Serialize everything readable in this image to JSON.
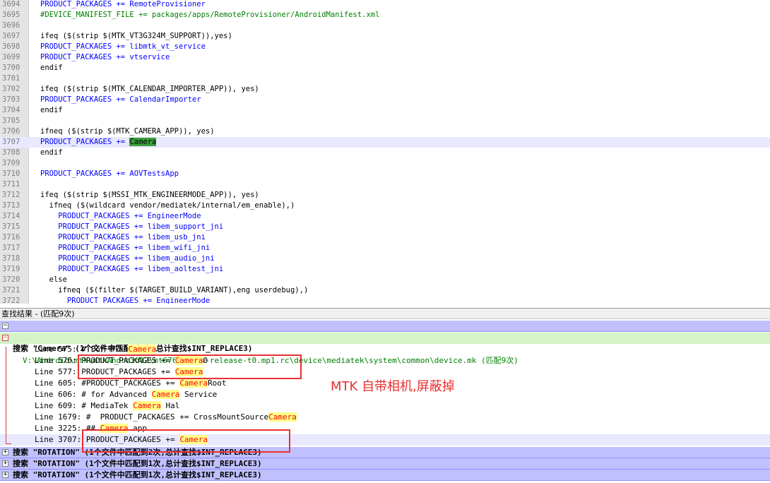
{
  "editor": {
    "lines": [
      {
        "n": "3694",
        "t": "PRODUCT_PACKAGES += RemoteProvisioner",
        "k": "var"
      },
      {
        "n": "3695",
        "t": "#DEVICE_MANIFEST_FILE += packages/apps/RemoteProvisioner/AndroidManifest.xml",
        "k": "comment"
      },
      {
        "n": "3696",
        "t": "",
        "k": "plain"
      },
      {
        "n": "3697",
        "t": "ifeq ($(strip $(MTK_VT3G324M_SUPPORT)),yes)",
        "k": "plain"
      },
      {
        "n": "3698",
        "t": "PRODUCT_PACKAGES += libmtk_vt_service",
        "k": "var"
      },
      {
        "n": "3699",
        "t": "PRODUCT_PACKAGES += vtservice",
        "k": "var"
      },
      {
        "n": "3700",
        "t": "endif",
        "k": "plain"
      },
      {
        "n": "3701",
        "t": "",
        "k": "plain"
      },
      {
        "n": "3702",
        "t": "ifeq ($(strip $(MTK_CALENDAR_IMPORTER_APP)), yes)",
        "k": "plain"
      },
      {
        "n": "3703",
        "t": "PRODUCT_PACKAGES += CalendarImporter",
        "k": "var"
      },
      {
        "n": "3704",
        "t": "endif",
        "k": "plain"
      },
      {
        "n": "3705",
        "t": "",
        "k": "plain"
      },
      {
        "n": "3706",
        "t": "ifneq ($(strip $(MTK_CAMERA_APP)), yes)",
        "k": "plain"
      },
      {
        "n": "3707",
        "t": "PRODUCT_PACKAGES += ",
        "k": "var",
        "hl": "Camera",
        "current": true
      },
      {
        "n": "3708",
        "t": "endif",
        "k": "plain"
      },
      {
        "n": "3709",
        "t": "",
        "k": "plain"
      },
      {
        "n": "3710",
        "t": "PRODUCT_PACKAGES += AOVTestsApp",
        "k": "var"
      },
      {
        "n": "3711",
        "t": "",
        "k": "plain"
      },
      {
        "n": "3712",
        "t": "ifeq ($(strip $(MSSI_MTK_ENGINEERMODE_APP)), yes)",
        "k": "plain"
      },
      {
        "n": "3713",
        "t": "  ifneq ($(wildcard vendor/mediatek/internal/em_enable),)",
        "k": "plain"
      },
      {
        "n": "3714",
        "t": "    PRODUCT_PACKAGES += EngineerMode",
        "k": "var"
      },
      {
        "n": "3715",
        "t": "    PRODUCT_PACKAGES += libem_support_jni",
        "k": "var"
      },
      {
        "n": "3716",
        "t": "    PRODUCT_PACKAGES += libem_usb_jni",
        "k": "var"
      },
      {
        "n": "3717",
        "t": "    PRODUCT_PACKAGES += libem_wifi_jni",
        "k": "var"
      },
      {
        "n": "3718",
        "t": "    PRODUCT_PACKAGES += libem_audio_jni",
        "k": "var"
      },
      {
        "n": "3719",
        "t": "    PRODUCT_PACKAGES += libem_aoltest_jni",
        "k": "var"
      },
      {
        "n": "3720",
        "t": "  else",
        "k": "plain"
      },
      {
        "n": "3721",
        "t": "    ifneq ($(filter $(TARGET_BUILD_VARIANT),eng userdebug),)",
        "k": "plain"
      },
      {
        "n": "3722",
        "t": "      PRODUCT_PACKAGES += EngineerMode",
        "k": "var"
      }
    ]
  },
  "results_pane": {
    "title": "查找结果 - (匹配9次)",
    "search1": {
      "label": "搜索 \"Camera\" (1个文件中匹配到9次,总计查找$INT_REPLACE3)"
    },
    "file": {
      "label": "V:\\Android\\mtk\\mtkAndroid12\\mt6769-alps-release-t0.mp1.rc\\device\\mediatek\\system\\common\\device.mk (匹配9次)"
    },
    "results": [
      {
        "pre": "Line 575: # For MTK ",
        "m": "Camera",
        "post": ""
      },
      {
        "pre": "Line 576: PRODUCT_PACKAGES += ",
        "m": "Camera",
        "post": "0"
      },
      {
        "pre": "Line 577: PRODUCT_PACKAGES += ",
        "m": "Camera",
        "post": ""
      },
      {
        "pre": "Line 605: #PRODUCT_PACKAGES += ",
        "m": "Camera",
        "post": "Root"
      },
      {
        "pre": "Line 606: # for Advanced ",
        "m": "Camera",
        "post": " Service"
      },
      {
        "pre": "Line 609: # MediaTek ",
        "m": "Camera",
        "post": " Hal"
      },
      {
        "pre": "Line 1679: #  PRODUCT_PACKAGES += CrossMountSource",
        "m": "Camera",
        "post": ""
      },
      {
        "pre": "Line 3225: ## ",
        "m": "Camera",
        "post": " app"
      },
      {
        "pre": "Line 3707: PRODUCT_PACKAGES += ",
        "m": "Camera",
        "post": "",
        "sel": true
      }
    ],
    "other_searches": [
      {
        "label": "搜索 \"ROTATION\" (1个文件中匹配到2次,总计查找$INT_REPLACE3)"
      },
      {
        "label": "搜索 \"ROTATION\" (1个文件中匹配到1次,总计查找$INT_REPLACE3)"
      },
      {
        "label": "搜索 \"ROTATION\" (1个文件中匹配到1次,总计查找$INT_REPLACE3)"
      }
    ]
  },
  "annotation": {
    "text": "MTK 自带相机,屏蔽掉",
    "color": "#e83030"
  },
  "icons": {
    "expanded": "minus-box-icon",
    "collapsed": "plus-box-icon"
  }
}
